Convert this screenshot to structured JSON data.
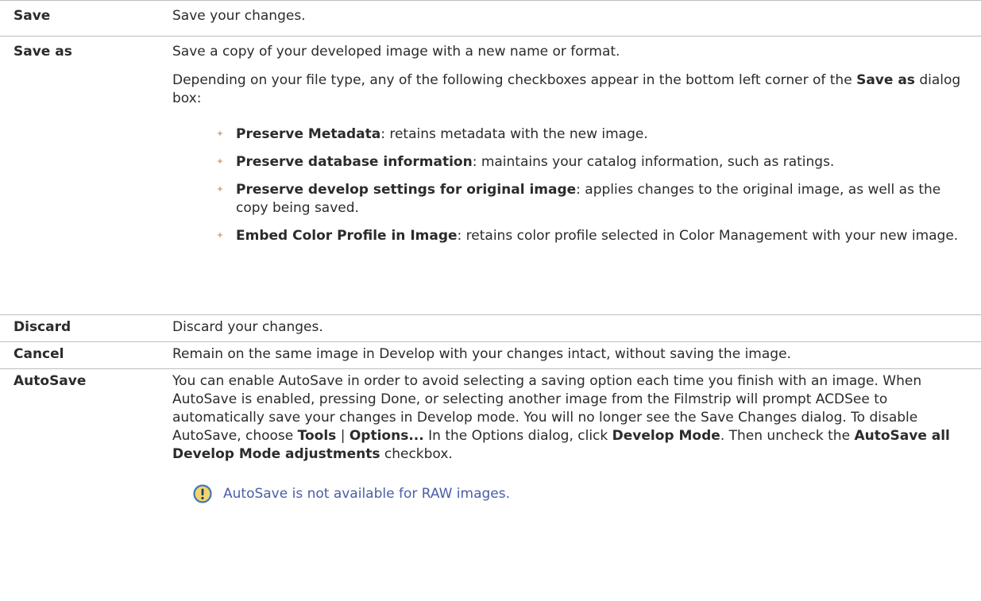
{
  "colors": {
    "rule": "#bdbdbd",
    "text": "#2b2b2b",
    "note_text": "#4a5da8",
    "bullet": "#d2a789",
    "note_icon_fill": "#f3d46a",
    "note_icon_stroke": "#3f78b5"
  },
  "rows": {
    "save": {
      "term": "Save",
      "desc": "Save your changes."
    },
    "save_as": {
      "term": "Save as",
      "desc": "Save a copy of your developed image with a new name or format.",
      "intro_a": "Depending on your file type, any of the following checkboxes appear in the bottom left corner of the ",
      "intro_bold": "Save as",
      "intro_b": " dialog box:",
      "bullets": [
        {
          "bold": "Preserve Metadata",
          "text": ": retains metadata with the new image."
        },
        {
          "bold": "Preserve database information",
          "text": ": maintains your catalog information, such as ratings."
        },
        {
          "bold": "Preserve develop settings for original image",
          "text": ": applies changes to the original image, as well as the copy being saved."
        },
        {
          "bold": "Embed Color Profile in Image",
          "text": ": retains color profile selected in Color Management with your new image."
        }
      ]
    },
    "discard": {
      "term": "Discard",
      "desc": "Discard your changes."
    },
    "cancel": {
      "term": "Cancel",
      "desc": "Remain on the same image in Develop with your changes intact, without saving the image."
    },
    "autosave": {
      "term": "AutoSave",
      "t1": "You can enable AutoSave in order to avoid selecting a saving option each time you finish with an image. When AutoSave is enabled, pressing Done, or selecting another image from the Filmstrip will prompt ACDSee to automatically save your changes in Develop mode. You will no longer see the Save Changes dialog. To disable AutoSave, choose ",
      "b1": "Tools",
      "t2": " | ",
      "b2": "Options...",
      "t3": " In the Options dialog, click ",
      "b3": "Develop Mode",
      "t4": ". Then uncheck the ",
      "b4": "AutoSave all Develop Mode adjustments",
      "t5": " checkbox.",
      "note_icon": "exclamation-info-icon",
      "note": "AutoSave is not available for RAW images."
    }
  }
}
